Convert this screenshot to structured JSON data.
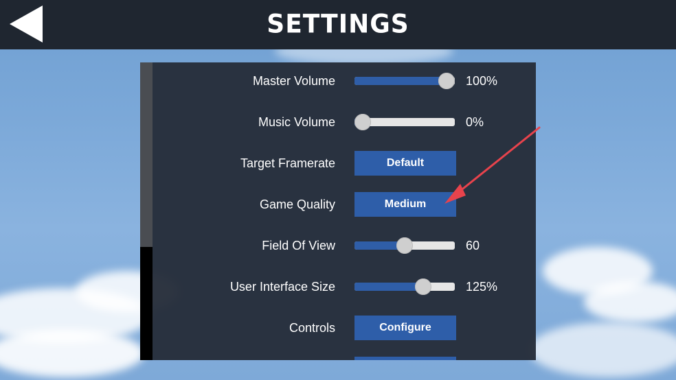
{
  "header": {
    "title": "SETTINGS",
    "back_icon": "back-arrow-icon"
  },
  "settings": {
    "master_volume": {
      "label": "Master Volume",
      "value_text": "100%",
      "level": 1.0
    },
    "music_volume": {
      "label": "Music Volume",
      "value_text": "0%",
      "level": 0.0
    },
    "target_framerate": {
      "label": "Target Framerate",
      "button": "Default"
    },
    "game_quality": {
      "label": "Game Quality",
      "button": "Medium"
    },
    "field_of_view": {
      "label": "Field Of View",
      "value_text": "60",
      "level": 0.5
    },
    "ui_size": {
      "label": "User Interface Size",
      "value_text": "125%",
      "level": 0.72
    },
    "controls": {
      "label": "Controls",
      "button": "Configure"
    }
  },
  "scrollbar": {
    "position": 0.0,
    "visible_fraction": 0.62
  },
  "colors": {
    "topbar": "#1f2630",
    "panel": "#252d39",
    "button": "#2e5ea9",
    "slider_fill": "#2f5ea8",
    "annotation_arrow": "#e8434c"
  }
}
